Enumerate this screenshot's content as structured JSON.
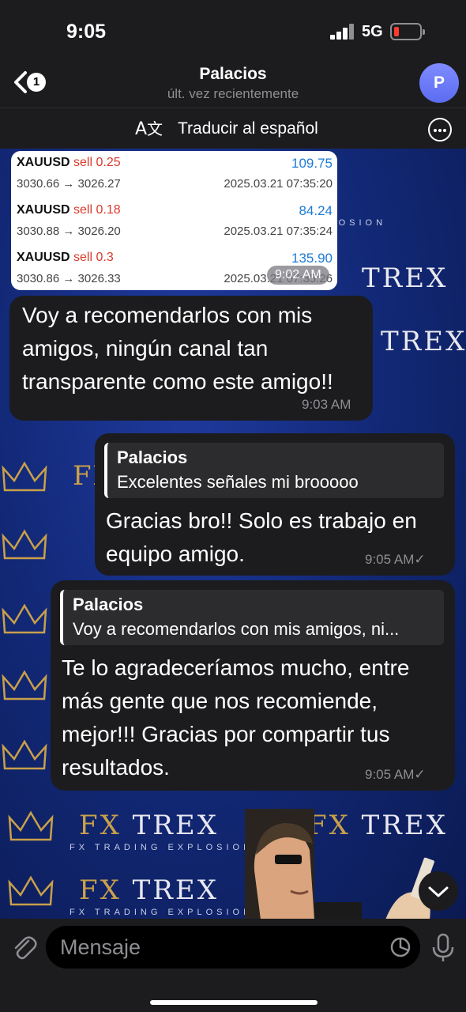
{
  "status": {
    "time": "9:05",
    "network": "5G"
  },
  "header": {
    "back_count": "1",
    "name": "Palacios",
    "last_seen": "últ. vez recientemente",
    "avatar_letter": "P"
  },
  "translate": {
    "label": "Traducir al español"
  },
  "watermark": {
    "fx": "FX",
    "trex": "TREX",
    "tagline": "FX TRADING EXPLOSION"
  },
  "trades": [
    {
      "symbol": "XAUUSD",
      "side": "sell 0.25",
      "profit": "109.75",
      "prices": "3030.66 → 3026.27",
      "stamp": "2025.03.21 07:35:20"
    },
    {
      "symbol": "XAUUSD",
      "side": "sell 0.18",
      "profit": "84.24",
      "prices": "3030.88 → 3026.20",
      "stamp": "2025.03.21 07:35:24"
    },
    {
      "symbol": "XAUUSD",
      "side": "sell 0.3",
      "profit": "135.90",
      "prices": "3030.86 → 3026.33",
      "stamp": "2025.03.21 07:35:26"
    }
  ],
  "messages": {
    "image_time": "9:02 AM",
    "m1": {
      "text": "Voy a recomendarlos con mis amigos, ningún canal tan transparente como este amigo!!",
      "time": "9:03 AM"
    },
    "m2": {
      "reply_name": "Palacios",
      "reply_text": "Excelentes señales mi brooooo",
      "text": "Gracias bro!! Solo es trabajo en equipo amigo.",
      "time": "9:05 AM✓"
    },
    "m3": {
      "reply_name": "Palacios",
      "reply_text": "Voy a recomendarlos con mis amigos, ni...",
      "text": "Te lo agradeceríamos mucho, entre más gente que nos recomiende, mejor!!! Gracias por compartir tus resultados.",
      "time": "9:05 AM✓"
    }
  },
  "composer": {
    "placeholder": "Mensaje"
  },
  "colors": {
    "accent_blue": "#1e7ad6",
    "sell_red": "#d93a2b",
    "bubble": "#1c1c1e",
    "gold": "#c9a04a"
  }
}
